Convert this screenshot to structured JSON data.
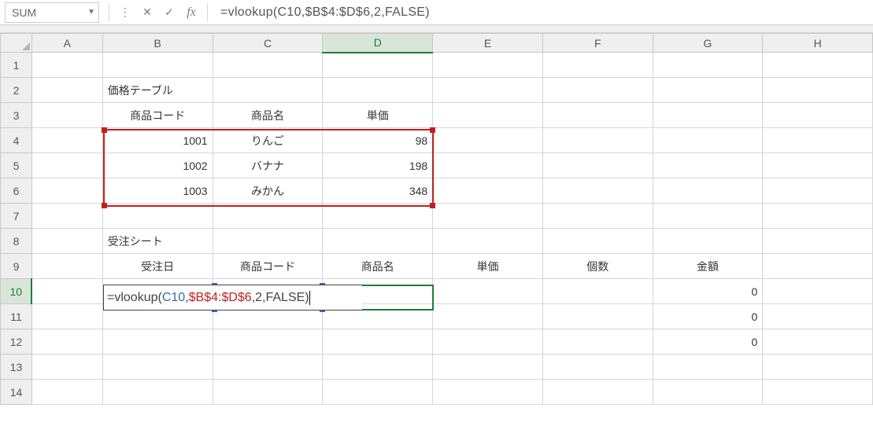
{
  "formula_bar": {
    "name_box": "SUM",
    "cancel_icon": "✕",
    "enter_icon": "✓",
    "fx_icon": "fx",
    "dots_icon": "⋮",
    "formula": "=vlookup(C10,$B$4:$D$6,2,FALSE)"
  },
  "columns": [
    "A",
    "B",
    "C",
    "D",
    "E",
    "F",
    "G",
    "H"
  ],
  "rows": [
    "1",
    "2",
    "3",
    "4",
    "5",
    "6",
    "7",
    "8",
    "9",
    "10",
    "11",
    "12",
    "13",
    "14"
  ],
  "active_column": "D",
  "active_row": "10",
  "chart_data": {
    "type": "table",
    "tables": [
      {
        "name": "価格テーブル",
        "location": "B2",
        "header_row": "B3:D3",
        "data_range": "B4:D6",
        "columns": [
          "商品コード",
          "商品名",
          "単価"
        ],
        "rows": [
          [
            1001,
            "りんご",
            98
          ],
          [
            1002,
            "バナナ",
            198
          ],
          [
            1003,
            "みかん",
            348
          ]
        ]
      },
      {
        "name": "受注シート",
        "location": "B8",
        "header_row": "B9:G9",
        "data_range": "B10:G12",
        "columns": [
          "受注日",
          "商品コード",
          "商品名",
          "単価",
          "個数",
          "金額"
        ],
        "rows": [
          [
            "",
            "",
            "",
            "",
            "",
            0
          ],
          [
            "",
            "",
            "",
            "",
            "",
            0
          ],
          [
            "",
            "",
            "",
            "",
            "",
            0
          ]
        ]
      }
    ],
    "highlighted_ranges": {
      "red": "$B$4:$D$6",
      "blue": "C10"
    },
    "active_cell": "D10",
    "editing_formula": "=vlookup(C10,$B$4:$D$6,2,FALSE)"
  },
  "cells": {
    "B2": "価格テーブル",
    "B3": "商品コード",
    "C3": "商品名",
    "D3": "単価",
    "B4": "1001",
    "C4": "りんご",
    "D4": "98",
    "B5": "1002",
    "C5": "バナナ",
    "D5": "198",
    "B6": "1003",
    "C6": "みかん",
    "D6": "348",
    "B8": "受注シート",
    "B9": "受注日",
    "C9": "商品コード",
    "D9": "商品名",
    "E9": "単価",
    "F9": "個数",
    "G9": "金額",
    "G10": "0",
    "G11": "0",
    "G12": "0"
  },
  "edit": {
    "prefix": "=vlookup(",
    "tok_blue": "C10",
    "mid1": ",",
    "tok_red": "$B$4:$D$6",
    "suffix": ",2,FALSE)"
  }
}
